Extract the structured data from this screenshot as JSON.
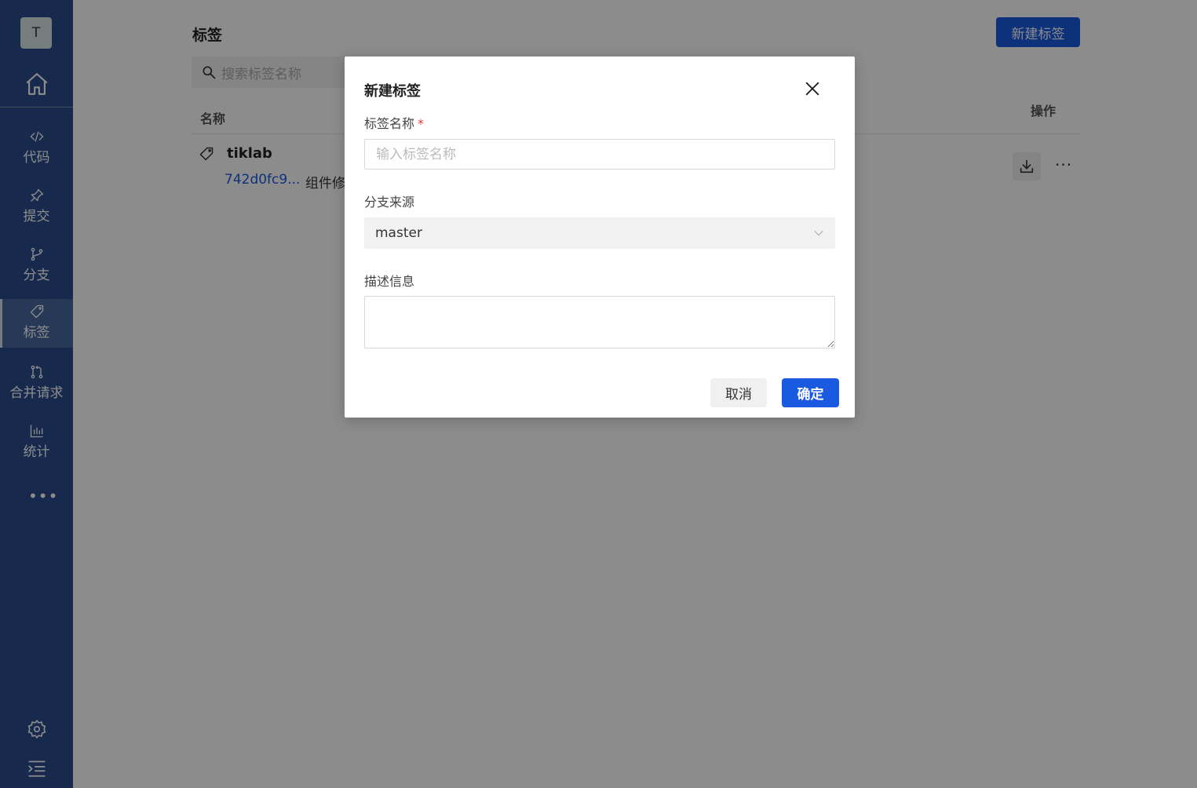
{
  "sidebar": {
    "avatar_letter": "T",
    "items": [
      {
        "label": "代码",
        "icon": "code-icon"
      },
      {
        "label": "提交",
        "icon": "pin-icon"
      },
      {
        "label": "分支",
        "icon": "branch-icon"
      },
      {
        "label": "标签",
        "icon": "tag-icon",
        "active": true
      },
      {
        "label": "合并请求",
        "icon": "merge-request-icon"
      },
      {
        "label": "统计",
        "icon": "bar-chart-icon"
      }
    ],
    "more": "•••"
  },
  "main": {
    "title": "标签",
    "new_button": "新建标签",
    "search_placeholder": "搜索标签名称",
    "table": {
      "col_name": "名称",
      "col_ops": "操作",
      "rows": [
        {
          "tag": "tiklab",
          "commit": "742d0fc9...",
          "message": "组件修"
        }
      ]
    },
    "ops_more": "···"
  },
  "modal": {
    "title": "新建标签",
    "tag_name_label": "标签名称",
    "required_mark": "*",
    "tag_name_placeholder": "输入标签名称",
    "source_label": "分支来源",
    "source_value": "master",
    "desc_label": "描述信息",
    "cancel": "取消",
    "ok": "确定"
  },
  "colors": {
    "sidebar_bg": "#2b4d8e",
    "primary": "#1a5ae0",
    "required": "#e0383e"
  }
}
